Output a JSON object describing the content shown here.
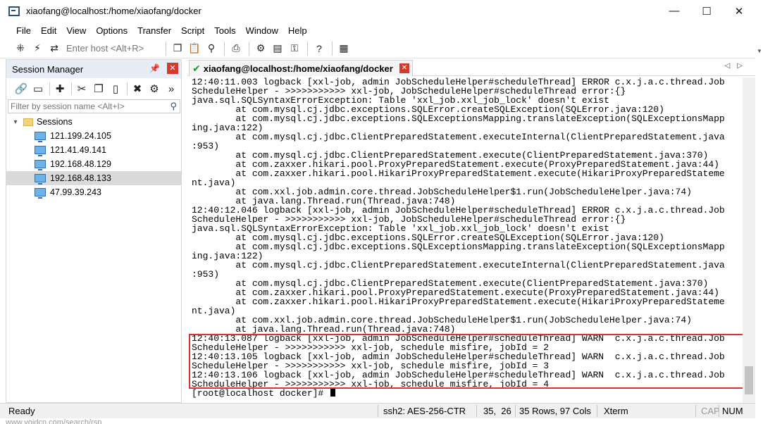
{
  "window": {
    "title": "xiaofang@localhost:/home/xiaofang/docker",
    "minimize": "—",
    "maximize": "☐",
    "close": "✕"
  },
  "menu": [
    "File",
    "Edit",
    "View",
    "Options",
    "Transfer",
    "Script",
    "Tools",
    "Window",
    "Help"
  ],
  "toolbar": {
    "host_placeholder": "Enter host <Alt+R>"
  },
  "session_manager": {
    "title": "Session Manager",
    "filter_placeholder": "Filter by session name <Alt+I>",
    "root": "Sessions",
    "sessions": [
      "121.199.24.105",
      "121.41.49.141",
      "192.168.48.129",
      "192.168.48.133",
      "47.99.39.243"
    ],
    "selected_index": 3
  },
  "tab": {
    "label": "xiaofang@localhost:/home/xiaofang/docker"
  },
  "terminal": {
    "lines": [
      "12:40:11.003 logback [xxl-job, admin JobScheduleHelper#scheduleThread] ERROR c.x.j.a.c.thread.Job",
      "ScheduleHelper - >>>>>>>>>>> xxl-job, JobScheduleHelper#scheduleThread error:{}",
      "java.sql.SQLSyntaxErrorException: Table 'xxl_job.xxl_job_lock' doesn't exist",
      "        at com.mysql.cj.jdbc.exceptions.SQLError.createSQLException(SQLError.java:120)",
      "        at com.mysql.cj.jdbc.exceptions.SQLExceptionsMapping.translateException(SQLExceptionsMapp",
      "ing.java:122)",
      "        at com.mysql.cj.jdbc.ClientPreparedStatement.executeInternal(ClientPreparedStatement.java",
      ":953)",
      "        at com.mysql.cj.jdbc.ClientPreparedStatement.execute(ClientPreparedStatement.java:370)",
      "        at com.zaxxer.hikari.pool.ProxyPreparedStatement.execute(ProxyPreparedStatement.java:44)",
      "        at com.zaxxer.hikari.pool.HikariProxyPreparedStatement.execute(HikariProxyPreparedStateme",
      "nt.java)",
      "        at com.xxl.job.admin.core.thread.JobScheduleHelper$1.run(JobScheduleHelper.java:74)",
      "        at java.lang.Thread.run(Thread.java:748)",
      "12:40:12.046 logback [xxl-job, admin JobScheduleHelper#scheduleThread] ERROR c.x.j.a.c.thread.Job",
      "ScheduleHelper - >>>>>>>>>>> xxl-job, JobScheduleHelper#scheduleThread error:{}",
      "java.sql.SQLSyntaxErrorException: Table 'xxl_job.xxl_job_lock' doesn't exist",
      "        at com.mysql.cj.jdbc.exceptions.SQLError.createSQLException(SQLError.java:120)",
      "        at com.mysql.cj.jdbc.exceptions.SQLExceptionsMapping.translateException(SQLExceptionsMapp",
      "ing.java:122)",
      "        at com.mysql.cj.jdbc.ClientPreparedStatement.executeInternal(ClientPreparedStatement.java",
      ":953)",
      "        at com.mysql.cj.jdbc.ClientPreparedStatement.execute(ClientPreparedStatement.java:370)",
      "        at com.zaxxer.hikari.pool.ProxyPreparedStatement.execute(ProxyPreparedStatement.java:44)",
      "        at com.zaxxer.hikari.pool.HikariProxyPreparedStatement.execute(HikariProxyPreparedStateme",
      "nt.java)",
      "        at com.xxl.job.admin.core.thread.JobScheduleHelper$1.run(JobScheduleHelper.java:74)",
      "        at java.lang.Thread.run(Thread.java:748)",
      "12:40:13.087 logback [xxl-job, admin JobScheduleHelper#scheduleThread] WARN  c.x.j.a.c.thread.Job",
      "ScheduleHelper - >>>>>>>>>>> xxl-job, schedule misfire, jobId = 2",
      "12:40:13.105 logback [xxl-job, admin JobScheduleHelper#scheduleThread] WARN  c.x.j.a.c.thread.Job",
      "ScheduleHelper - >>>>>>>>>>> xxl-job, schedule misfire, jobId = 3",
      "12:40:13.106 logback [xxl-job, admin JobScheduleHelper#scheduleThread] WARN  c.x.j.a.c.thread.Job",
      "ScheduleHelper - >>>>>>>>>>> xxl-job, schedule misfire, jobId = 4"
    ],
    "prompt": "[root@localhost docker]# "
  },
  "status": {
    "ready": "Ready",
    "ssh": "ssh2: AES-256-CTR",
    "cursor": "35,  26",
    "size": "35 Rows, 97 Cols",
    "term": "Xterm",
    "cap": "CAP",
    "num": "NUM"
  },
  "footer": "www.voidcn.com/search/rsp"
}
